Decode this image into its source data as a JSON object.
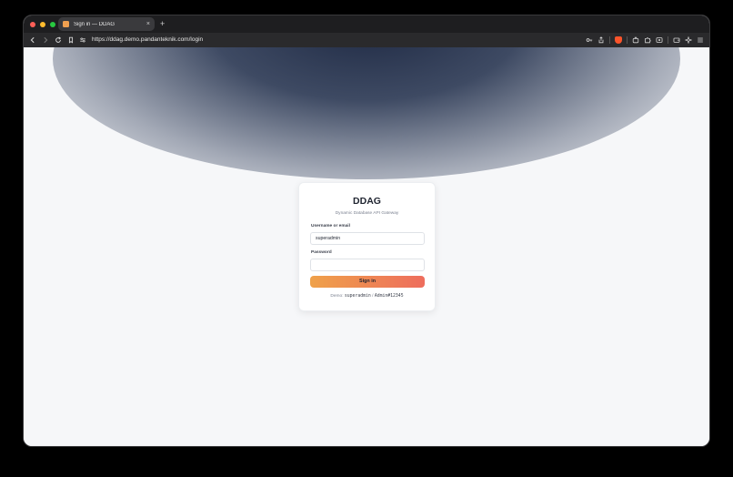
{
  "browser": {
    "tab": {
      "title": "Sign in — DDAG",
      "close_glyph": "×"
    },
    "new_tab_glyph": "+",
    "url": "https://ddag.demo.pandanteknik.com/login"
  },
  "login": {
    "brand": "DDAG",
    "subtitle": "Dynamic Database API Gateway",
    "username_label": "Username or email",
    "username_value": "superadmin",
    "password_label": "Password",
    "password_value": "",
    "submit_label": "Sign in",
    "demo_prefix": "Demo:",
    "demo_username": "superadmin",
    "demo_separator": "/",
    "demo_password": "Admin#12345"
  },
  "colors": {
    "button_gradient_start": "#efa14a",
    "button_gradient_end": "#ee6d5d",
    "page_background": "#f6f7f9"
  }
}
